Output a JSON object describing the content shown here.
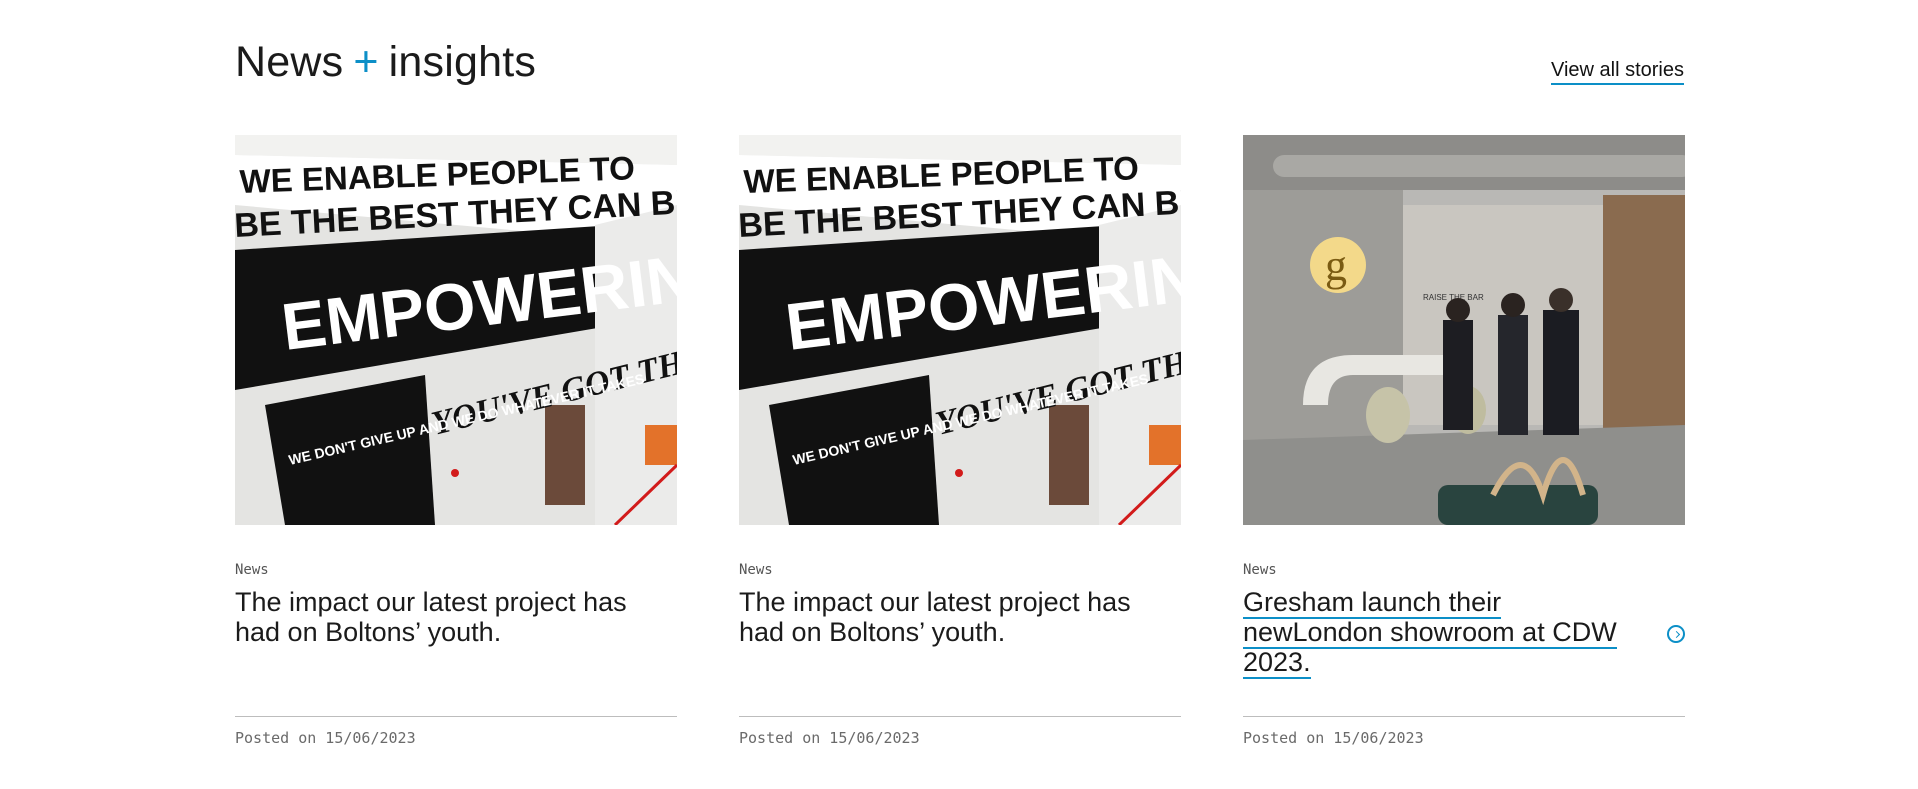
{
  "section": {
    "title_left": "News",
    "title_plus": "+",
    "title_right": "insights",
    "view_all": "View all stories"
  },
  "cards": [
    {
      "image": "mural-empowering-photo",
      "category": "News",
      "headline": "The impact our latest project has had on Boltons’ youth.",
      "posted": "Posted on 15/06/2023",
      "mural_text": [
        "WE ENABLE PEOPLE TO",
        "BE THE BEST THEY CAN BE",
        "EMPOWERING",
        "YOU'VE GOT THE DRIVE",
        "WE DON'T GIVE UP AND WE DO WHATEVER IT TAKES"
      ]
    },
    {
      "image": "mural-empowering-photo",
      "category": "News",
      "headline": "The impact our latest project has had on Boltons’ youth.",
      "posted": "Posted on 15/06/2023",
      "mural_text": [
        "WE ENABLE PEOPLE TO",
        "BE THE BEST THEY CAN BE",
        "EMPOWERING",
        "YOU'VE GOT THE DRIVE",
        "WE DON'T GIVE UP AND WE DO WHATEVER IT TAKES"
      ]
    },
    {
      "image": "showroom-photo",
      "category": "News",
      "headline": "Gresham launch their newLondon showroom at CDW 2023.",
      "posted": "Posted on 15/06/2023",
      "showroom_text": [
        "RAISE THE BAR"
      ]
    }
  ],
  "colors": {
    "accent": "#0c8fc7",
    "rule": "#bdbdbd"
  },
  "icons": {
    "arrow": "chevron-right-circle-icon"
  }
}
